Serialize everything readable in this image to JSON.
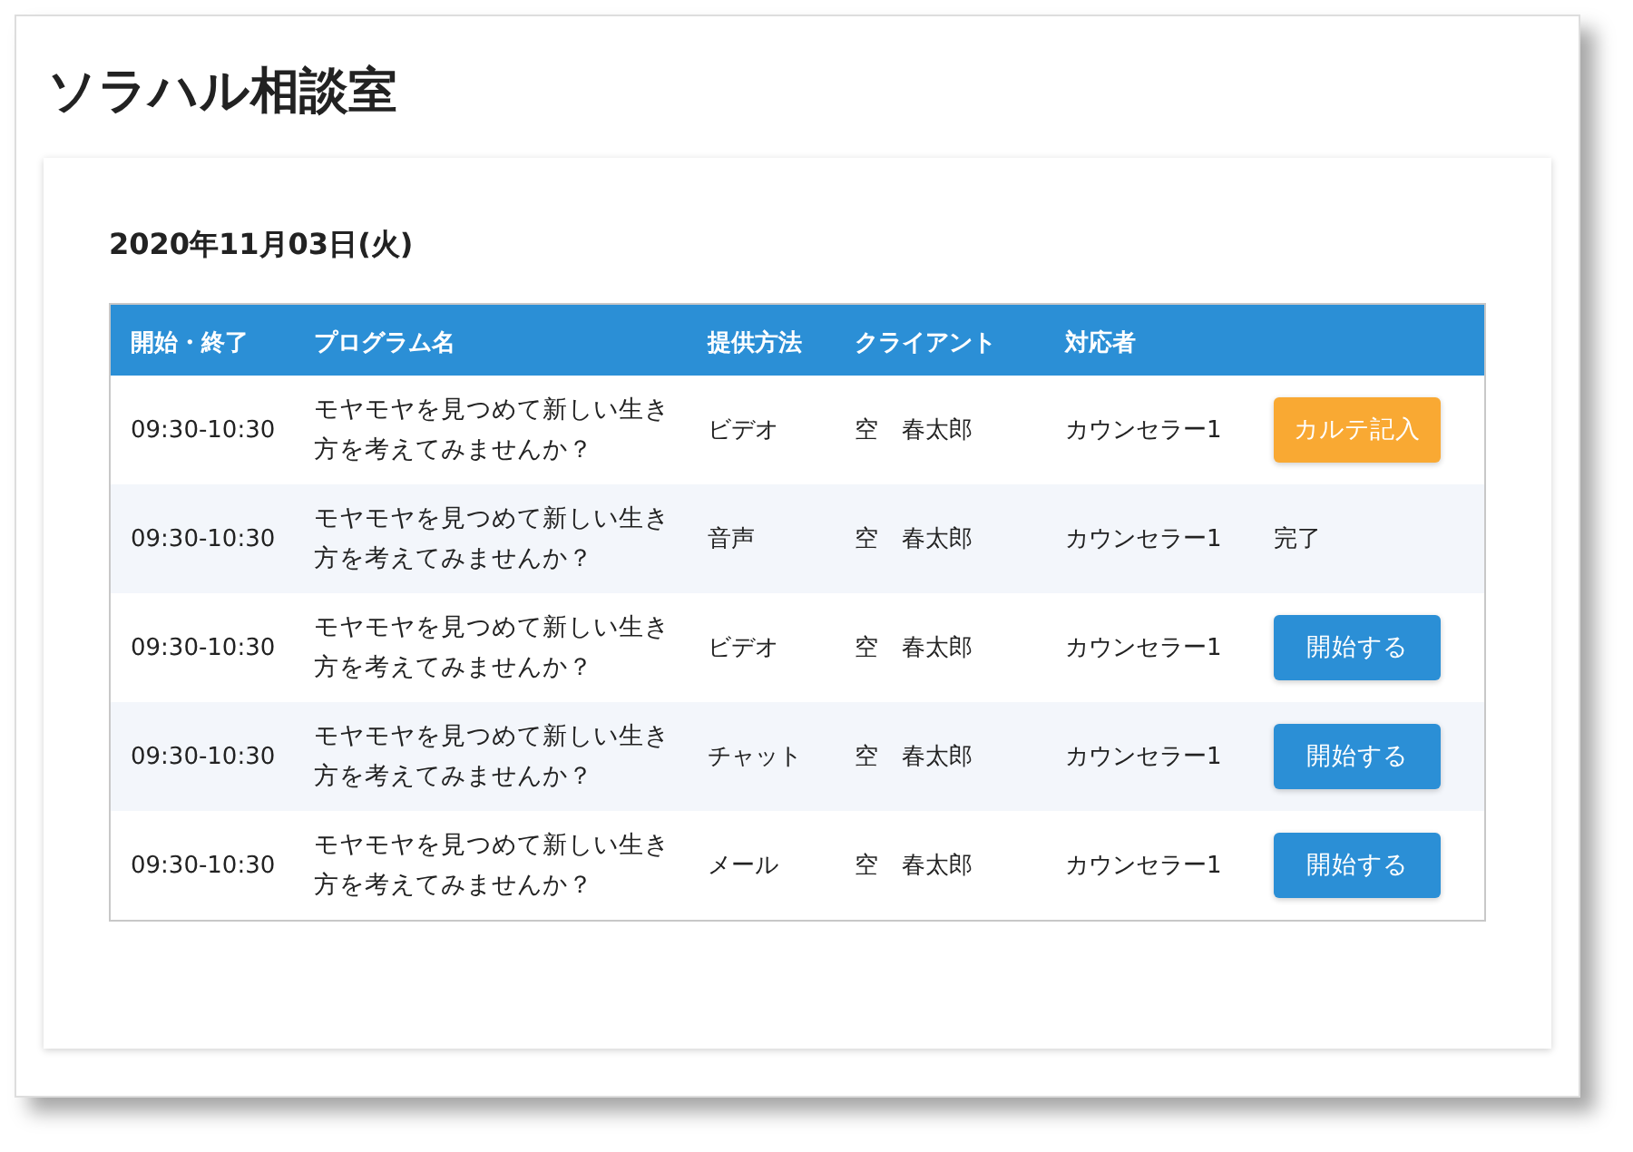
{
  "title": "ソラハル相談室",
  "date": "2020年11月03日(火)",
  "table": {
    "columns": [
      "開始・終了",
      "プログラム名",
      "提供方法",
      "クライアント",
      "対応者"
    ],
    "rows": [
      {
        "time": "09:30-10:30",
        "program": "モヤモヤを見つめて新しい生き方を考えてみませんか？",
        "method": "ビデオ",
        "client": "空　春太郎",
        "counselor": "カウンセラー1",
        "action": {
          "kind": "record",
          "label": "カルテ記入"
        }
      },
      {
        "time": "09:30-10:30",
        "program": "モヤモヤを見つめて新しい生き方を考えてみませんか？",
        "method": "音声",
        "client": "空　春太郎",
        "counselor": "カウンセラー1",
        "action": {
          "kind": "done",
          "label": "完了"
        }
      },
      {
        "time": "09:30-10:30",
        "program": "モヤモヤを見つめて新しい生き方を考えてみませんか？",
        "method": "ビデオ",
        "client": "空　春太郎",
        "counselor": "カウンセラー1",
        "action": {
          "kind": "start",
          "label": "開始する"
        }
      },
      {
        "time": "09:30-10:30",
        "program": "モヤモヤを見つめて新しい生き方を考えてみませんか？",
        "method": "チャット",
        "client": "空　春太郎",
        "counselor": "カウンセラー1",
        "action": {
          "kind": "start",
          "label": "開始する"
        }
      },
      {
        "time": "09:30-10:30",
        "program": "モヤモヤを見つめて新しい生き方を考えてみませんか？",
        "method": "メール",
        "client": "空　春太郎",
        "counselor": "カウンセラー1",
        "action": {
          "kind": "start",
          "label": "開始する"
        }
      }
    ]
  }
}
